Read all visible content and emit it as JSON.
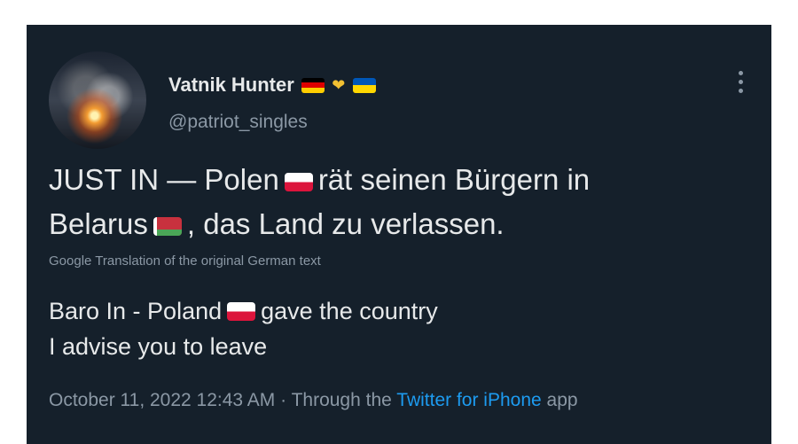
{
  "tweet": {
    "display_name": "Vatnik Hunter",
    "handle": "patriot_singles",
    "body_line1_before": "JUST IN — Polen",
    "body_line1_after": "rät seinen Bürgern in",
    "body_line2_before": "Belarus",
    "body_line2_after": ", das Land zu verlassen.",
    "translation_label": "Google Translation of the original German text",
    "translated_line1_before": "Baro In - Poland",
    "translated_line1_middle": "gave the country",
    "translated_line2": "I advise you to leave",
    "meta_before": "October 11, 2022 12:43 AM · Through the",
    "meta_app": "Twitter for iPhone",
    "meta_after": "app",
    "more_icon": "more-vertical-icon",
    "name_flags": [
      "germany-flag-icon",
      "handshake-icon",
      "ukraine-flag-icon"
    ]
  },
  "colors": {
    "background": "#15202b",
    "text": "#e7e9ea",
    "muted": "#8b98a5",
    "link": "#1d9bf0"
  }
}
